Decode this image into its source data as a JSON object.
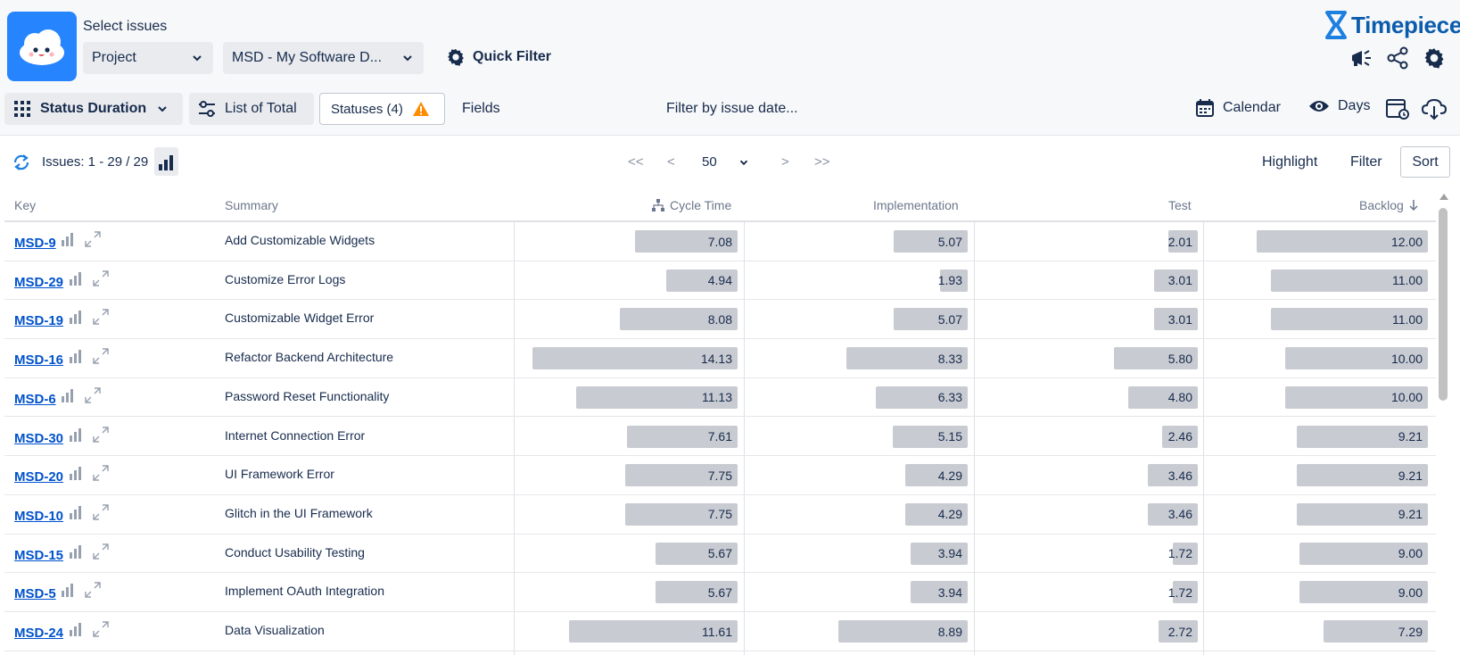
{
  "header": {
    "select_label": "Select issues",
    "project_dropdown": "Project",
    "project_value": "MSD - My Software D...",
    "quick_filter": "Quick Filter",
    "brand": "Timepiece"
  },
  "toolbar": {
    "report_type": "Status Duration",
    "list_of_total": "List of Total",
    "statuses": "Statuses (4)",
    "fields": "Fields",
    "filter_by_date": "Filter by issue date...",
    "calendar": "Calendar",
    "days": "Days"
  },
  "issues_bar": {
    "count": "Issues: 1 - 29 / 29",
    "page_size": "50",
    "first": "<<",
    "prev": "<",
    "next": ">",
    "last": ">>",
    "highlight": "Highlight",
    "filter": "Filter",
    "sort": "Sort"
  },
  "columns": {
    "key": "Key",
    "summary": "Summary",
    "cycle_time": "Cycle Time",
    "implementation": "Implementation",
    "test": "Test",
    "backlog": "Backlog"
  },
  "rows": [
    {
      "key": "MSD-9",
      "summary": "Add Customizable Widgets",
      "cycle_time": "7.08",
      "implementation": "5.07",
      "test": "2.01",
      "backlog": "12.00"
    },
    {
      "key": "MSD-29",
      "summary": "Customize Error Logs",
      "cycle_time": "4.94",
      "implementation": "1.93",
      "test": "3.01",
      "backlog": "11.00"
    },
    {
      "key": "MSD-19",
      "summary": "Customizable Widget Error",
      "cycle_time": "8.08",
      "implementation": "5.07",
      "test": "3.01",
      "backlog": "11.00"
    },
    {
      "key": "MSD-16",
      "summary": "Refactor Backend Architecture",
      "cycle_time": "14.13",
      "implementation": "8.33",
      "test": "5.80",
      "backlog": "10.00"
    },
    {
      "key": "MSD-6",
      "summary": "Password Reset Functionality",
      "cycle_time": "11.13",
      "implementation": "6.33",
      "test": "4.80",
      "backlog": "10.00"
    },
    {
      "key": "MSD-30",
      "summary": "Internet Connection Error",
      "cycle_time": "7.61",
      "implementation": "5.15",
      "test": "2.46",
      "backlog": "9.21"
    },
    {
      "key": "MSD-20",
      "summary": "UI Framework Error",
      "cycle_time": "7.75",
      "implementation": "4.29",
      "test": "3.46",
      "backlog": "9.21"
    },
    {
      "key": "MSD-10",
      "summary": "Glitch in the UI Framework",
      "cycle_time": "7.75",
      "implementation": "4.29",
      "test": "3.46",
      "backlog": "9.21"
    },
    {
      "key": "MSD-15",
      "summary": "Conduct Usability Testing",
      "cycle_time": "5.67",
      "implementation": "3.94",
      "test": "1.72",
      "backlog": "9.00"
    },
    {
      "key": "MSD-5",
      "summary": "Implement OAuth Integration",
      "cycle_time": "5.67",
      "implementation": "3.94",
      "test": "1.72",
      "backlog": "9.00"
    },
    {
      "key": "MSD-24",
      "summary": "Data Visualization",
      "cycle_time": "11.61",
      "implementation": "8.89",
      "test": "2.72",
      "backlog": "7.29"
    }
  ],
  "colors": {
    "accent": "#0052cc",
    "bar": "#c8cbd1",
    "warning": "#ff8b00"
  }
}
